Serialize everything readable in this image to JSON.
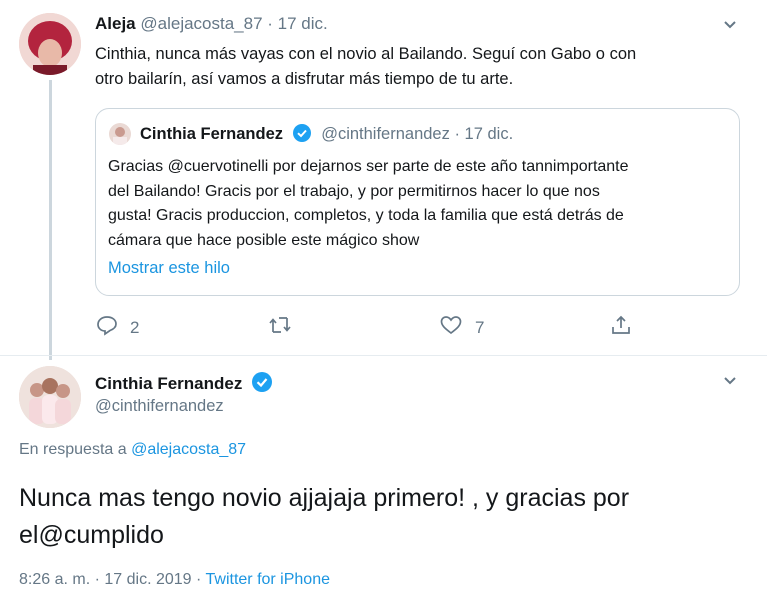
{
  "reply_tweet": {
    "author_name": "Aleja",
    "author_handle": "@alejacosta_87",
    "date": "· 17 dic.",
    "text_line1": "Cinthia, nunca más vayas con el novio al Bailando. Seguí con Gabo o con",
    "text_line2": "otro bailarín, así vamos a disfrutar más tiempo de tu arte.",
    "quoted": {
      "author_name": "Cinthia Fernandez",
      "author_handle": "@cinthifernandez",
      "date": "· 17 dic.",
      "text_line1": "Gracias @cuervotinelli por dejarnos ser parte de este año tannimportante",
      "text_line2": "del Bailando! Gracis por el trabajo, y por permitirnos hacer lo que nos",
      "text_line3": "gusta! Gracis produccion, completos, y toda la familia que está detrás de",
      "text_line4": "cámara que hace posible este mágico show",
      "show_thread": "Mostrar este hilo"
    },
    "actions": {
      "reply_count": "2",
      "retweet_count": "",
      "like_count": "7"
    }
  },
  "main_tweet": {
    "author_name": "Cinthia Fernandez",
    "author_handle": "@cinthifernandez",
    "in_reply_prefix": "En respuesta a",
    "in_reply_handle": "@alejacosta_87",
    "text_line1": "Nunca mas tengo novio ajjajaja primero! , y gracias por",
    "text_line2": "el@cumplido",
    "time": "8:26 a. m.",
    "date": "· 17 dic. 2019 ·",
    "source": "Twitter for iPhone"
  },
  "colors": {
    "accent": "#1b95e0",
    "secondary_text": "#657786",
    "border": "#ccd6dd"
  },
  "icons": [
    "chevron-down-icon",
    "verified-badge-icon",
    "reply-icon",
    "retweet-icon",
    "like-icon",
    "share-icon"
  ]
}
